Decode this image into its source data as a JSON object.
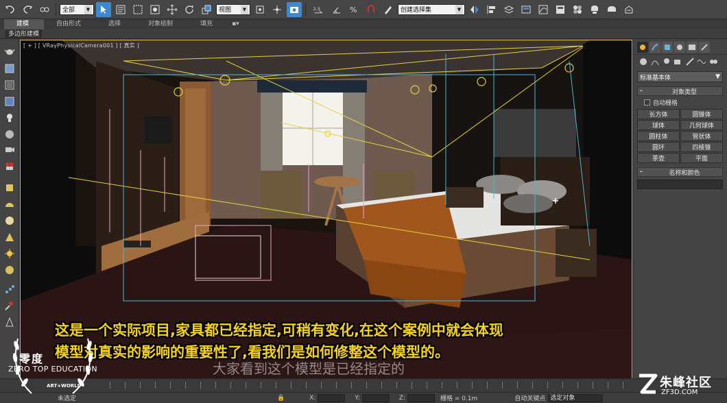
{
  "toolbar": {
    "filter_select": "全部",
    "view_select": "视图",
    "snap_angle": "2.5",
    "named_selection": "创建选择集",
    "icons": [
      "undo-icon",
      "redo-icon",
      "link-icon",
      "unlink-icon",
      "bind-spacewarp-icon",
      "select-object-icon",
      "select-by-name-icon",
      "rect-selection-icon",
      "window-crossing-icon",
      "move-icon",
      "rotate-icon",
      "scale-icon",
      "pivot-icon",
      "manipulate-icon",
      "snap-icon",
      "angle-snap-icon",
      "percent-snap-icon",
      "spinner-snap-icon",
      "edit-named-selection-icon",
      "mirror-icon",
      "align-icon",
      "layer-icon",
      "graphite-icon",
      "curve-editor-icon",
      "schematic-icon",
      "material-editor-icon",
      "render-setup-icon",
      "rendered-frame-icon",
      "render-icon"
    ]
  },
  "ribbon": {
    "tabs": [
      {
        "label": "建模",
        "active": true
      },
      {
        "label": "自由形式",
        "active": false
      },
      {
        "label": "选择",
        "active": false
      },
      {
        "label": "对象绘制",
        "active": false
      },
      {
        "label": "填充",
        "active": false
      }
    ],
    "sub_label": "多边形建模"
  },
  "viewport": {
    "label": "[ + ] [ VRayPhysicalCamera001 ] [ 真实 ]"
  },
  "command_panel": {
    "dropdown": "标准基本体",
    "object_type_title": "对象类型",
    "autogrid_label": "自动栅格",
    "buttons": [
      "长方体",
      "圆锥体",
      "球体",
      "几何球体",
      "圆柱体",
      "管状体",
      "圆环",
      "四棱锥",
      "茶壶",
      "平面"
    ],
    "name_color_title": "名称和颜色"
  },
  "subtitle": {
    "line1": "这是一个实际项目,家具都已经指定,可稍有变化,在这个案例中就会体现",
    "line2": "模型对真实的影响的重要性了,看我们是如何修整这个模型的。",
    "ghost": "大家看到这个模型是已经指定的"
  },
  "logo": {
    "zh": "零度",
    "en": "ZERO TOP EDUCATION",
    "art": "ART+WORLD"
  },
  "watermark": {
    "zh": "朱峰社区",
    "url": "ZF3D.COM"
  },
  "statusbar": {
    "left_text": "未选定",
    "x_label": "X:",
    "y_label": "Y:",
    "z_label": "Z:",
    "grid_text": "栅格 = 0.1m",
    "autokey": "自动关键点",
    "selected_select": "选定对象"
  },
  "colors": {
    "accent": "#3f88d0",
    "viewport_border": "#d8b23a",
    "subtitle": "#f6d21a"
  }
}
